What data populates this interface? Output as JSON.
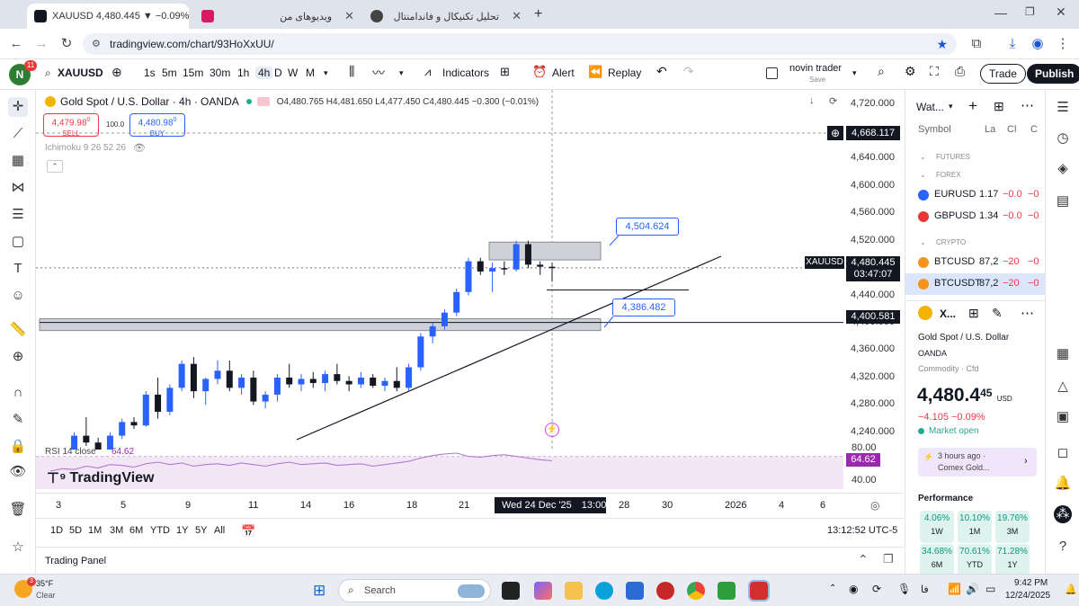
{
  "browser": {
    "tabs": [
      {
        "label": "XAUUSD 4,480.445 ▼ −0.09% u",
        "active": true
      },
      {
        "label": "ویدیوهای من",
        "active": false
      },
      {
        "label": "تحلیل تکنیکال و فاندامنتال",
        "active": false
      }
    ],
    "url": "tradingview.com/chart/93HoXxUU/"
  },
  "toolbar": {
    "symbol": "XAUUSD",
    "timeframes": [
      "1s",
      "5m",
      "15m",
      "30m",
      "1h",
      "4h",
      "D",
      "W",
      "M"
    ],
    "active_timeframe": "4h",
    "indicators": "Indicators",
    "alert": "Alert",
    "replay": "Replay",
    "layout_name": "novin trader",
    "layout_sub": "Save",
    "trade": "Trade",
    "publish": "Publish",
    "avatar_letter": "N",
    "avatar_badge": "11"
  },
  "chart": {
    "title": "Gold Spot / U.S. Dollar · 4h · OANDA",
    "ohlc": "O4,480.765 H4,481.650 L4,477.450 C4,480.445 −0.300 (−0.01%)",
    "sell_price": "4,479.98",
    "sell_sup": "0",
    "sell_label": "SELL",
    "spread": "100.0",
    "buy_price": "4,480.98",
    "buy_sup": "0",
    "buy_label": "BUY",
    "indicator_legend": "Ichimoku 9 26 52 26",
    "price_ticks": [
      "4,720.000",
      "4,680.000",
      "4,640.000",
      "4,600.000",
      "4,560.000",
      "4,520.000",
      "4,480.000",
      "4,440.000",
      "4,400.000",
      "4,360.000",
      "4,320.000",
      "4,280.000",
      "4,240.000"
    ],
    "crosshair_price": "4,668.117",
    "symbol_tag": "XAUUSD",
    "last_price": "4,480.445",
    "countdown": "03:47:07",
    "level_price": "4,400.581",
    "annotation_upper": "4,504.624",
    "annotation_lower": "4,386.482",
    "rsi_legend": "RSI 14 close",
    "rsi_value": "64.62",
    "rsi_ticks": [
      "80.00",
      "40.00"
    ],
    "watermark": "TradingView",
    "time_ticks": [
      "3",
      "5",
      "9",
      "11",
      "14",
      "16",
      "18",
      "21",
      "28",
      "30",
      "2026",
      "4",
      "6"
    ],
    "crosshair_time": "Wed 24 Dec '25",
    "crosshair_hour": "13:00",
    "ranges": [
      "1D",
      "5D",
      "1M",
      "3M",
      "6M",
      "YTD",
      "1Y",
      "5Y",
      "All"
    ],
    "clock": "13:12:52 UTC-5",
    "trading_panel": "Trading Panel"
  },
  "chart_data": {
    "type": "candlestick",
    "series_colors": {
      "up": "#2962ff",
      "down": "#131722"
    },
    "ylim": [
      4220,
      4730
    ],
    "x_labels": [
      "3",
      "5",
      "9",
      "11",
      "14",
      "16",
      "18",
      "21",
      "24 Dec '25",
      "28",
      "30",
      "2026",
      "4",
      "6"
    ],
    "candles": [
      [
        4195,
        4205,
        4180,
        4200
      ],
      [
        4200,
        4205,
        4195,
        4203
      ],
      [
        4203,
        4240,
        4198,
        4235
      ],
      [
        4235,
        4262,
        4220,
        4225
      ],
      [
        4225,
        4232,
        4200,
        4210
      ],
      [
        4210,
        4240,
        4205,
        4235
      ],
      [
        4235,
        4260,
        4230,
        4255
      ],
      [
        4255,
        4262,
        4245,
        4250
      ],
      [
        4250,
        4300,
        4248,
        4295
      ],
      [
        4295,
        4320,
        4260,
        4270
      ],
      [
        4270,
        4310,
        4265,
        4305
      ],
      [
        4305,
        4345,
        4300,
        4340
      ],
      [
        4340,
        4350,
        4290,
        4300
      ],
      [
        4300,
        4320,
        4280,
        4318
      ],
      [
        4318,
        4345,
        4310,
        4330
      ],
      [
        4330,
        4345,
        4300,
        4305
      ],
      [
        4305,
        4325,
        4295,
        4320
      ],
      [
        4320,
        4330,
        4280,
        4285
      ],
      [
        4285,
        4300,
        4275,
        4295
      ],
      [
        4295,
        4325,
        4285,
        4320
      ],
      [
        4320,
        4340,
        4305,
        4310
      ],
      [
        4310,
        4325,
        4300,
        4318
      ],
      [
        4318,
        4328,
        4305,
        4312
      ],
      [
        4312,
        4330,
        4300,
        4325
      ],
      [
        4325,
        4340,
        4310,
        4315
      ],
      [
        4315,
        4322,
        4300,
        4310
      ],
      [
        4310,
        4328,
        4305,
        4320
      ],
      [
        4320,
        4325,
        4305,
        4308
      ],
      [
        4308,
        4320,
        4300,
        4315
      ],
      [
        4315,
        4335,
        4300,
        4305
      ],
      [
        4305,
        4340,
        4300,
        4335
      ],
      [
        4335,
        4385,
        4330,
        4380
      ],
      [
        4380,
        4400,
        4370,
        4395
      ],
      [
        4395,
        4420,
        4390,
        4415
      ],
      [
        4415,
        4450,
        4410,
        4445
      ],
      [
        4445,
        4495,
        4440,
        4490
      ],
      [
        4490,
        4495,
        4470,
        4475
      ],
      [
        4475,
        4488,
        4445,
        4480
      ],
      [
        4480,
        4490,
        4470,
        4478
      ],
      [
        4478,
        4520,
        4475,
        4515
      ],
      [
        4515,
        4520,
        4480,
        4485
      ],
      [
        4485,
        4490,
        4470,
        4482
      ],
      [
        4482,
        4488,
        4460,
        4480
      ]
    ],
    "rsi": [
      52,
      55,
      54,
      58,
      56,
      60,
      59,
      57,
      61,
      63,
      60,
      62,
      58,
      60,
      61,
      59,
      62,
      60,
      58,
      61,
      63,
      60,
      61,
      62,
      59,
      60,
      61,
      58,
      60,
      62,
      64,
      68,
      71,
      73,
      74,
      70,
      69,
      71,
      72,
      70,
      68,
      66,
      64.62
    ]
  },
  "watchlist": {
    "title": "Wat...",
    "columns": [
      "Symbol",
      "La",
      "Cl",
      "C"
    ],
    "group_futures": "FUTURES",
    "group_forex": "FOREX",
    "group_crypto": "CRYPTO",
    "rows": [
      {
        "symbol": "EURUSD",
        "last": "1.17",
        "chg": "−0.0",
        "chgp": "−0",
        "color": "#2962ff"
      },
      {
        "symbol": "GBPUSD",
        "last": "1.34",
        "chg": "−0.0",
        "chgp": "−0",
        "color": "#e53935"
      },
      {
        "symbol": "BTCUSD",
        "last": "87,2",
        "chg": "−20",
        "chgp": "−0",
        "color": "#f7931a"
      },
      {
        "symbol": "BTCUSDT",
        "last": "87,2",
        "chg": "−20",
        "chgp": "−0",
        "color": "#f7931a"
      }
    ],
    "detail_symbol": "X...",
    "detail_name": "Gold Spot / U.S. Dollar",
    "detail_exchange": "OANDA",
    "detail_type": "Commodity · Cfd",
    "detail_price": "4,480.4",
    "detail_price_sup": "45",
    "detail_currency": "USD",
    "detail_change": "−4.105 −0.09%",
    "market_status": "Market open",
    "news_time": "3 hours ago ·",
    "news_text": "Comex Gold...",
    "performance_title": "Performance",
    "performance": [
      {
        "value": "4.06%",
        "label": "1W"
      },
      {
        "value": "10.10%",
        "label": "1M"
      },
      {
        "value": "19.76%",
        "label": "3M"
      },
      {
        "value": "34.68%",
        "label": "6M"
      },
      {
        "value": "70.61%",
        "label": "YTD"
      },
      {
        "value": "71.28%",
        "label": "1Y"
      }
    ]
  },
  "taskbar": {
    "weather_temp": "35°F",
    "weather_text": "Clear",
    "search": "Search",
    "lang": "فا",
    "time": "9:42 PM",
    "date": "12/24/2025"
  }
}
